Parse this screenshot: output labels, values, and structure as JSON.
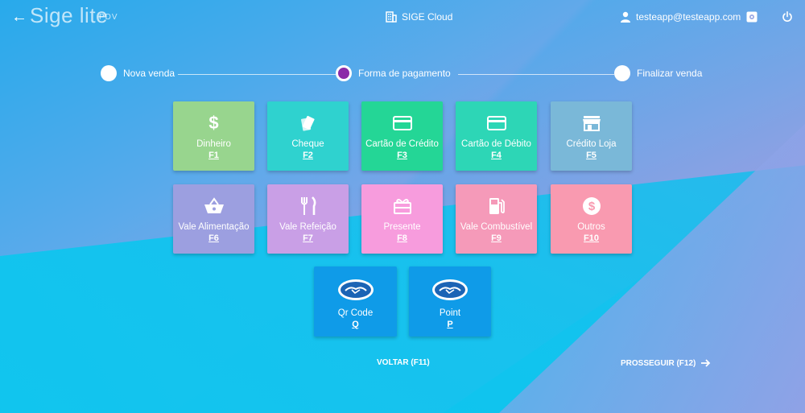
{
  "header": {
    "back_icon": "arrow-left-icon",
    "logo": "Sige lite",
    "logo_sub": "PDV",
    "cloud_label": "SIGE Cloud",
    "user_email": "testeapp@testeapp.com"
  },
  "stepper": {
    "steps": [
      {
        "label": "Nova venda",
        "active": false
      },
      {
        "label": "Forma de pagamento",
        "active": true
      },
      {
        "label": "Finalizar venda",
        "active": false
      }
    ]
  },
  "payment_methods": [
    {
      "label": "Dinheiro",
      "key": "F1",
      "icon": "dollar-icon",
      "color": "#98d58e"
    },
    {
      "label": "Cheque",
      "key": "F2",
      "icon": "cheque-icon",
      "color": "#2fd2cf"
    },
    {
      "label": "Cartão de Crédito",
      "key": "F3",
      "icon": "credit-card-icon",
      "color": "#24d696"
    },
    {
      "label": "Cartão de Débito",
      "key": "F4",
      "icon": "debit-card-icon",
      "color": "#2dd6b6"
    },
    {
      "label": "Crédito Loja",
      "key": "F5",
      "icon": "store-icon",
      "color": "#7ab8d8"
    },
    {
      "label": "Vale Alimentação",
      "key": "F6",
      "icon": "basket-icon",
      "color": "#9c9fe0"
    },
    {
      "label": "Vale Refeição",
      "key": "F7",
      "icon": "utensils-icon",
      "color": "#c99fe6"
    },
    {
      "label": "Presente",
      "key": "F8",
      "icon": "gift-icon",
      "color": "#f79cdd"
    },
    {
      "label": "Vale Combustível",
      "key": "F9",
      "icon": "fuel-icon",
      "color": "#f59ab9"
    },
    {
      "label": "Outros",
      "key": "F10",
      "icon": "coin-icon",
      "color": "#f99ab0"
    },
    {
      "label": "Qr Code",
      "key": "Q",
      "icon": "mercadopago-icon",
      "color": "#0f9be8"
    },
    {
      "label": "Point",
      "key": "P",
      "icon": "mercadopago-icon",
      "color": "#0f9be8"
    }
  ],
  "footer": {
    "voltar": "VOLTAR (F11)",
    "prosseguir": "PROSSEGUIR (F12)"
  }
}
